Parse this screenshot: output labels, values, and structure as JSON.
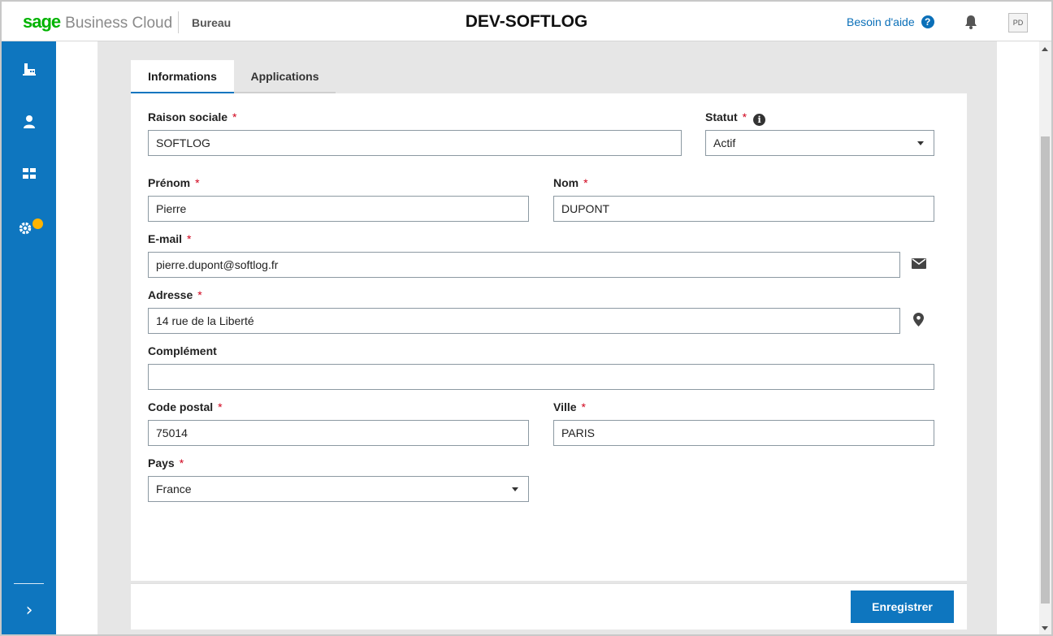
{
  "header": {
    "logo_brand": "sage",
    "logo_product": "Business Cloud",
    "context": "Bureau",
    "title": "DEV-SOFTLOG",
    "help_label": "Besoin d'aide",
    "help_icon": "?",
    "avatar_initials": "PD"
  },
  "sidebar": {
    "items": [
      {
        "name": "company-icon"
      },
      {
        "name": "user-icon"
      },
      {
        "name": "apps-grid-icon"
      },
      {
        "name": "settings-icon"
      }
    ],
    "expand_icon": "›"
  },
  "tabs": [
    {
      "label": "Informations",
      "active": true
    },
    {
      "label": "Applications",
      "active": false
    }
  ],
  "form": {
    "raison_sociale": {
      "label": "Raison sociale",
      "required": "*",
      "value": "SOFTLOG"
    },
    "statut": {
      "label": "Statut",
      "required": "*",
      "value": "Actif",
      "info_icon": "i"
    },
    "prenom": {
      "label": "Prénom",
      "required": "*",
      "value": "Pierre"
    },
    "nom": {
      "label": "Nom",
      "required": "*",
      "value": "DUPONT"
    },
    "email": {
      "label": "E-mail",
      "required": "*",
      "value": "pierre.dupont@softlog.fr"
    },
    "adresse": {
      "label": "Adresse",
      "required": "*",
      "value": "14 rue de la Liberté"
    },
    "complement": {
      "label": "Complément",
      "value": ""
    },
    "code_postal": {
      "label": "Code postal",
      "required": "*",
      "value": "75014"
    },
    "ville": {
      "label": "Ville",
      "required": "*",
      "value": "PARIS"
    },
    "pays": {
      "label": "Pays",
      "required": "*",
      "value": "France"
    }
  },
  "actions": {
    "save_label": "Enregistrer"
  },
  "colors": {
    "brand_green": "#00b300",
    "primary_blue": "#0e76bf",
    "required_red": "#d0021b",
    "notification_dot": "#ffb400"
  }
}
